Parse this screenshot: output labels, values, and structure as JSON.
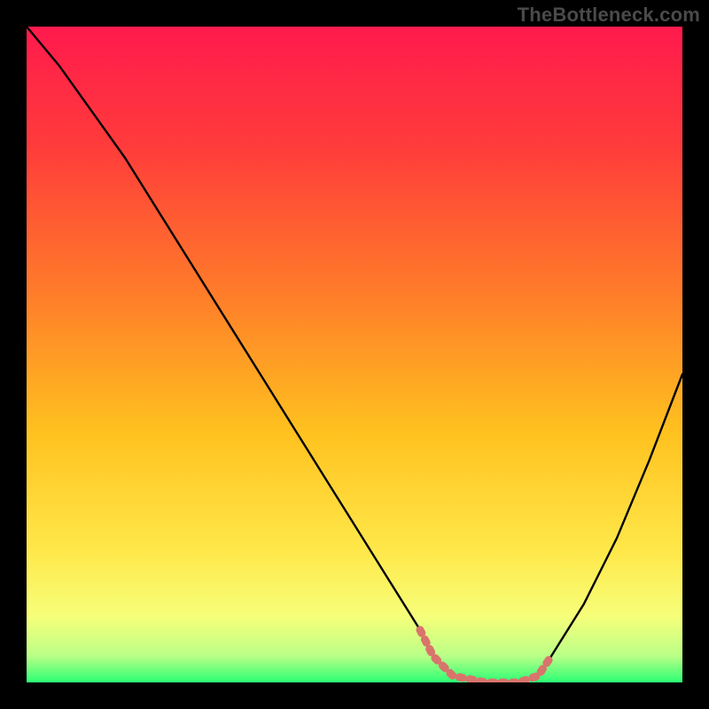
{
  "watermark": "TheBottleneck.com",
  "chart_data": {
    "type": "line",
    "title": "",
    "xlabel": "",
    "ylabel": "",
    "xlim": [
      0,
      100
    ],
    "ylim": [
      0,
      100
    ],
    "grid": false,
    "legend": false,
    "background_gradient": {
      "type": "vertical",
      "stops": [
        {
          "offset": 0.0,
          "color": "#ff1a4d"
        },
        {
          "offset": 0.18,
          "color": "#ff3b3b"
        },
        {
          "offset": 0.4,
          "color": "#ff7a2a"
        },
        {
          "offset": 0.62,
          "color": "#ffc21f"
        },
        {
          "offset": 0.8,
          "color": "#ffe84a"
        },
        {
          "offset": 0.9,
          "color": "#f6ff7a"
        },
        {
          "offset": 0.96,
          "color": "#b9ff87"
        },
        {
          "offset": 1.0,
          "color": "#2bff74"
        }
      ]
    },
    "series": [
      {
        "name": "bottleneck-curve",
        "x": [
          0,
          5,
          10,
          15,
          20,
          25,
          30,
          35,
          40,
          45,
          50,
          55,
          60,
          62,
          65,
          70,
          75,
          78,
          80,
          85,
          90,
          95,
          100
        ],
        "y": [
          100,
          94,
          87,
          80,
          72,
          64,
          56,
          48,
          40,
          32,
          24,
          16,
          8,
          4,
          1,
          0,
          0,
          1,
          4,
          12,
          22,
          34,
          47
        ]
      }
    ],
    "overlay_segments": [
      {
        "name": "highlighted-valley",
        "color": "#d9746c",
        "stroke_width": 9,
        "dash": [
          4,
          8
        ],
        "x": [
          60,
          62,
          65,
          70,
          75,
          78,
          80
        ],
        "y": [
          8,
          4,
          1,
          0,
          0,
          1,
          4
        ]
      }
    ]
  }
}
